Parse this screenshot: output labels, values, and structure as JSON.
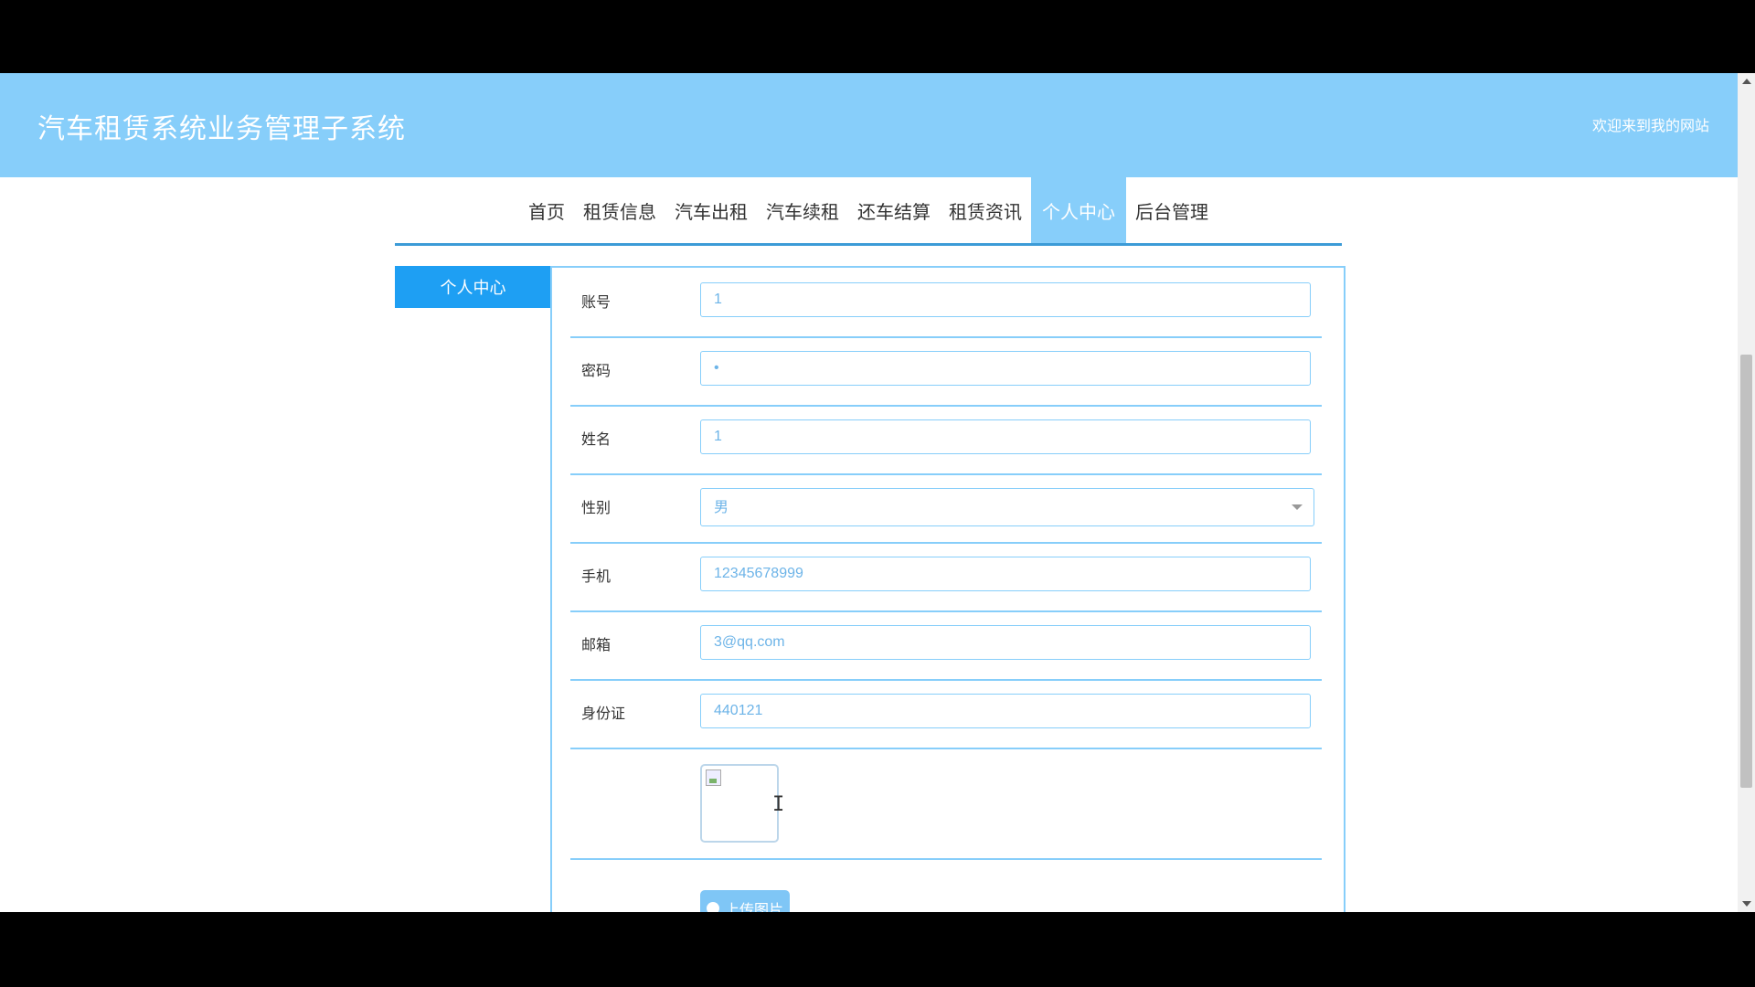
{
  "header": {
    "site_title": "汽车租赁系统业务管理子系统",
    "welcome": "欢迎来到我的网站"
  },
  "nav": {
    "items": [
      {
        "label": "首页"
      },
      {
        "label": "租赁信息"
      },
      {
        "label": "汽车出租"
      },
      {
        "label": "汽车续租"
      },
      {
        "label": "还车结算"
      },
      {
        "label": "租赁资讯"
      },
      {
        "label": "个人中心"
      },
      {
        "label": "后台管理"
      }
    ],
    "active": "个人中心"
  },
  "sidebar": {
    "tab_label": "个人中心"
  },
  "form": {
    "account": {
      "label": "账号",
      "value": "1"
    },
    "password": {
      "label": "密码",
      "value": "•"
    },
    "name": {
      "label": "姓名",
      "value": "1"
    },
    "gender": {
      "label": "性别",
      "value": "男"
    },
    "phone": {
      "label": "手机",
      "value": "12345678999"
    },
    "email": {
      "label": "邮箱",
      "value": "3@qq.com"
    },
    "id_card": {
      "label": "身份证",
      "value": "440121"
    },
    "upload_label": "上传图片"
  },
  "colors": {
    "header_bg": "#87cefa",
    "accent": "#1e9ff3",
    "input_text": "#6db4e8"
  }
}
